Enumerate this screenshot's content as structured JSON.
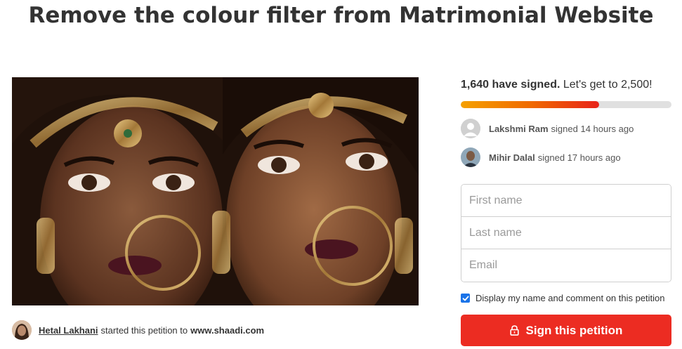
{
  "petition": {
    "title": "Remove the colour filter from Matrimonial Website"
  },
  "starter": {
    "name": "Hetal Lakhani",
    "started_text": "started this petition to",
    "target": "www.shaadi.com"
  },
  "signatures": {
    "count_label": "1,640 have signed.",
    "goal_label": "Let's get to 2,500!",
    "progress": 0.656
  },
  "recent_signers": [
    {
      "name": "Lakshmi Ram",
      "action": "signed 14 hours ago"
    },
    {
      "name": "Mihir Dalal",
      "action": "signed 17 hours ago"
    }
  ],
  "form": {
    "first_name_placeholder": "First name",
    "last_name_placeholder": "Last name",
    "email_placeholder": "Email"
  },
  "consent": {
    "label": "Display my name and comment on this petition",
    "checked": true
  },
  "sign_button": {
    "label": "Sign this petition"
  },
  "colors": {
    "primary_red": "#ec2c22",
    "progress_start": "#f5a000",
    "checkbox_blue": "#1a73e8"
  },
  "icons": [
    "lock-icon",
    "checkmark-icon",
    "default-avatar-icon"
  ]
}
